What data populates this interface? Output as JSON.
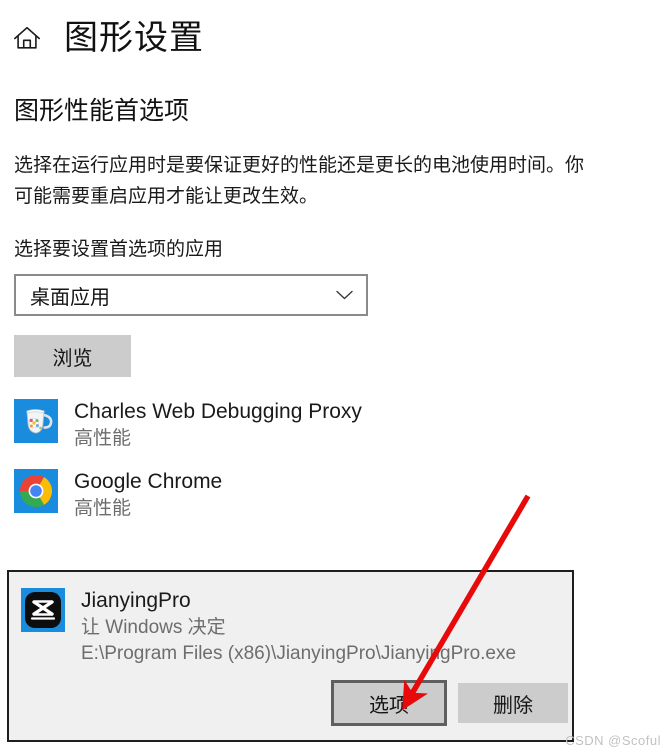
{
  "header": {
    "home_icon": "home-icon",
    "title": "图形设置"
  },
  "section": {
    "heading": "图形性能首选项",
    "description": "选择在运行应用时是要保证更好的性能还是更长的电池使用时间。你可能需要重启应用才能让更改生效。",
    "field_label": "选择要设置首选项的应用"
  },
  "dropdown": {
    "selected": "桌面应用",
    "chevron_icon": "chevron-down-icon"
  },
  "browse_button": {
    "label": "浏览"
  },
  "apps": [
    {
      "name": "Charles Web Debugging Proxy",
      "status": "高性能",
      "icon": "charles-icon"
    },
    {
      "name": "Google Chrome",
      "status": "高性能",
      "icon": "chrome-icon"
    }
  ],
  "selected_app": {
    "name": "JianyingPro",
    "status": "让 Windows 决定",
    "path": "E:\\Program Files (x86)\\JianyingPro\\JianyingPro.exe",
    "icon": "jianyingpro-icon",
    "options_button": "选项",
    "remove_button": "删除"
  },
  "annotation": {
    "arrow_color": "#e8090a",
    "arrow_target": "options-button"
  },
  "watermark": {
    "text": "CSDN @Scoful"
  },
  "colors": {
    "accent_blue": "#1a8cdd",
    "panel_bg": "#f0f0f0",
    "panel_border": "#1e1e1e",
    "button_bg": "#cccccc",
    "secondary_text": "#6d6d6d"
  }
}
